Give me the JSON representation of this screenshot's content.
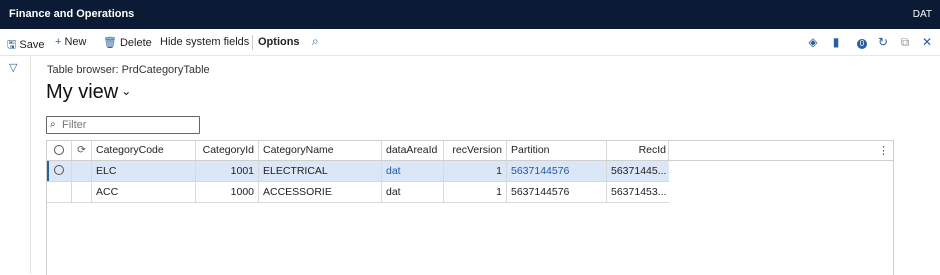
{
  "app": {
    "title": "Finance and Operations",
    "company": "DAT"
  },
  "actions": {
    "save": "Save",
    "new": "New",
    "delete": "Delete",
    "hide_system_fields": "Hide system fields",
    "options": "Options"
  },
  "icons": {
    "search": "search-icon",
    "filter": "filter-icon",
    "refresh": "refresh-icon",
    "notifications_badge": "0"
  },
  "page": {
    "breadcrumb": "Table browser: PrdCategoryTable",
    "view_title": "My view",
    "filter_placeholder": "Filter"
  },
  "grid": {
    "columns": [
      "CategoryCode",
      "CategoryId",
      "CategoryName",
      "dataAreaId",
      "recVersion",
      "Partition",
      "RecId"
    ],
    "rows": [
      {
        "CategoryCode": "ELC",
        "CategoryId": "1001",
        "CategoryName": "ELECTRICAL",
        "dataAreaId": "dat",
        "recVersion": "1",
        "Partition": "5637144576",
        "RecId": "56371445...",
        "selected": true
      },
      {
        "CategoryCode": "ACC",
        "CategoryId": "1000",
        "CategoryName": "ACCESSORIE",
        "dataAreaId": "dat",
        "recVersion": "1",
        "Partition": "5637144576",
        "RecId": "56371453...",
        "selected": false
      }
    ]
  },
  "colors": {
    "topbar": "#0b1b36",
    "accent": "#2a5f9e",
    "selected_row": "#dbe6f7",
    "link": "#1e5aa8"
  }
}
